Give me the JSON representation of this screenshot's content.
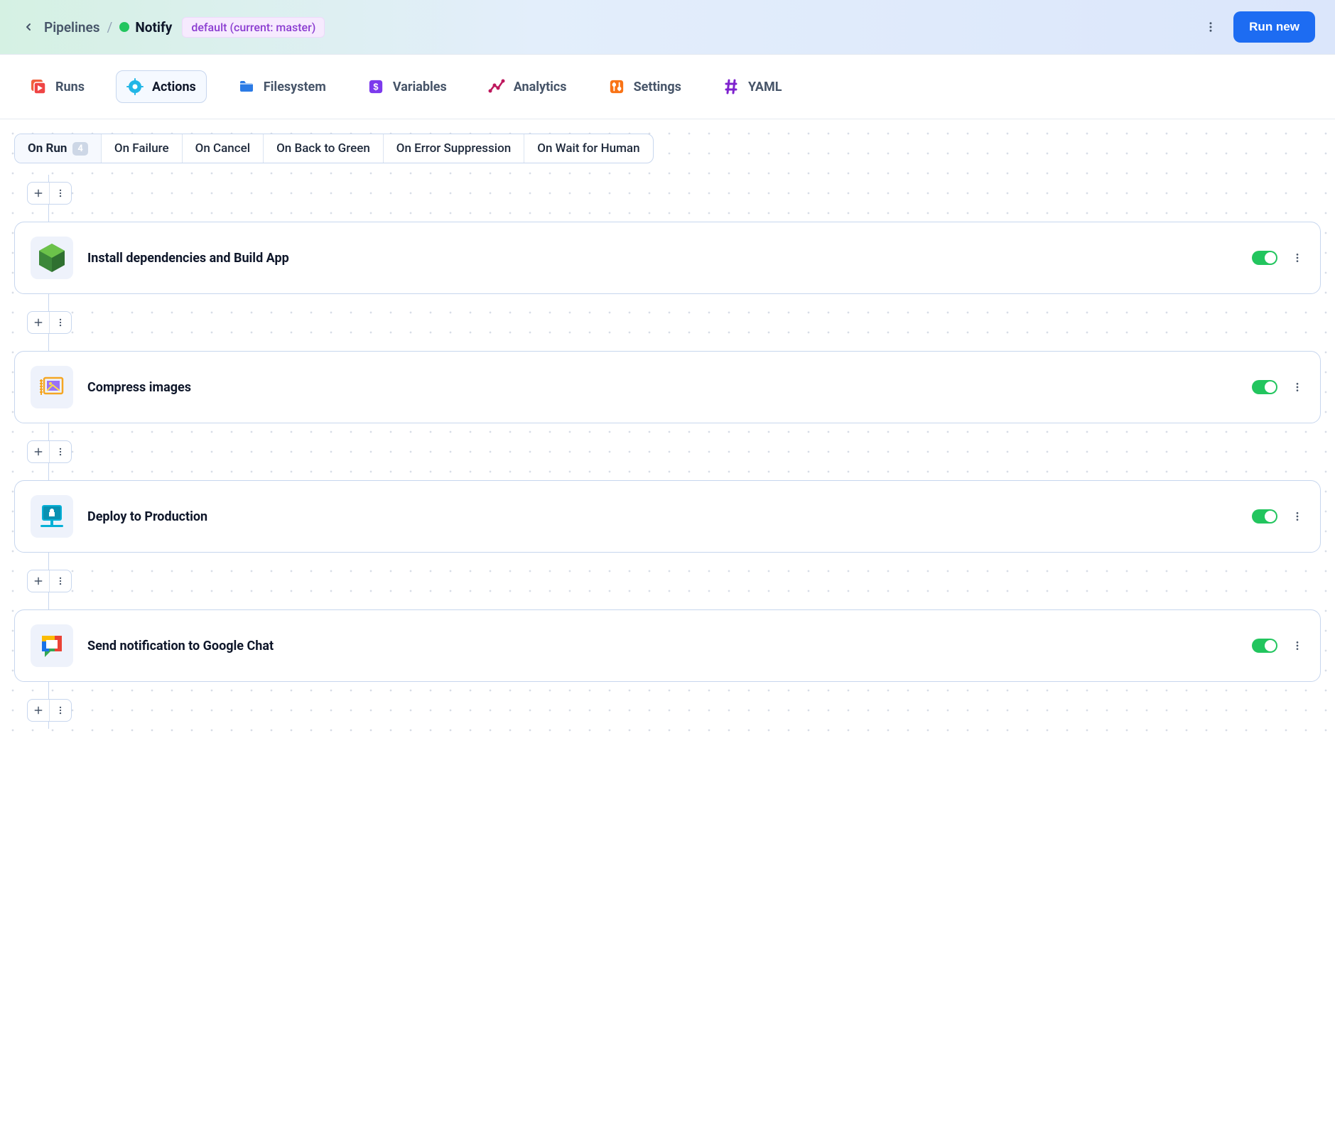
{
  "header": {
    "breadcrumb_root": "Pipelines",
    "breadcrumb_current": "Notify",
    "branch_chip": "default (current: master)",
    "run_new_label": "Run new"
  },
  "tabs": [
    {
      "id": "runs",
      "label": "Runs",
      "icon": "play-stack",
      "color": "#ef4444",
      "active": false
    },
    {
      "id": "actions",
      "label": "Actions",
      "icon": "gear",
      "color": "#22b6e6",
      "active": true
    },
    {
      "id": "filesystem",
      "label": "Filesystem",
      "icon": "folder",
      "color": "#2c7be5",
      "active": false
    },
    {
      "id": "variables",
      "label": "Variables",
      "icon": "dollar-block",
      "color": "#7c3aed",
      "active": false
    },
    {
      "id": "analytics",
      "label": "Analytics",
      "icon": "graph",
      "color": "#be185d",
      "active": false
    },
    {
      "id": "settings",
      "label": "Settings",
      "icon": "sliders",
      "color": "#f97316",
      "active": false
    },
    {
      "id": "yaml",
      "label": "YAML",
      "icon": "hash",
      "color": "#7e22ce",
      "active": false
    }
  ],
  "triggers": [
    {
      "label": "On Run",
      "count": "4",
      "active": true
    },
    {
      "label": "On Failure",
      "active": false
    },
    {
      "label": "On Cancel",
      "active": false
    },
    {
      "label": "On Back to Green",
      "active": false
    },
    {
      "label": "On Error Suppression",
      "active": false
    },
    {
      "label": "On Wait for Human",
      "active": false
    }
  ],
  "actions": [
    {
      "title": "Install dependencies and Build App",
      "icon": "nodejs",
      "enabled": true
    },
    {
      "title": "Compress images",
      "icon": "compress-image",
      "enabled": true
    },
    {
      "title": "Deploy to Production",
      "icon": "deploy-server",
      "enabled": true
    },
    {
      "title": "Send notification to Google Chat",
      "icon": "google-chat",
      "enabled": true
    }
  ]
}
